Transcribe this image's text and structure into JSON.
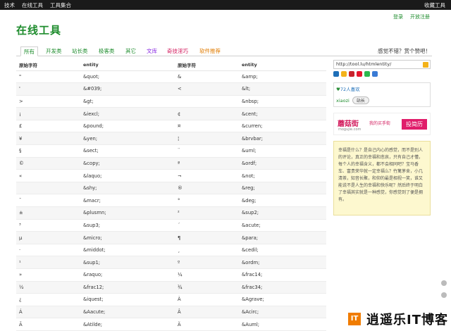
{
  "topbar": {
    "left": [
      "技术",
      "在线工具",
      "工具集合"
    ],
    "right": "收藏工具"
  },
  "user_links": {
    "login": "登录",
    "register": "开放注册"
  },
  "site_title": "在线工具",
  "tabs": [
    {
      "label": "所有",
      "color": "#1e8c2d"
    },
    {
      "label": "开发类",
      "color": "#1e8c2d"
    },
    {
      "label": "站长类",
      "color": "#1e8c2d"
    },
    {
      "label": "极客类",
      "color": "#1e8c2d"
    },
    {
      "label": "其它",
      "color": "#1e8c2d"
    },
    {
      "label": "文库",
      "color": "#8a2be2"
    },
    {
      "label": "奇技淫巧",
      "color": "#d21a5c"
    },
    {
      "label": "软件推荐",
      "color": "#e07b00"
    }
  ],
  "slogan": "感觉不错？赏个赞吧！",
  "table": {
    "headers": [
      "原始字符",
      "entity",
      "原始字符",
      "entity"
    ],
    "rows": [
      [
        "\"",
        "&quot;",
        "&",
        "&amp;"
      ],
      [
        "'",
        "&#039;",
        "<",
        "&lt;"
      ],
      [
        ">",
        "&gt;",
        "",
        "&nbsp;"
      ],
      [
        "¡",
        "&iexcl;",
        "¢",
        "&cent;"
      ],
      [
        "£",
        "&pound;",
        "¤",
        "&curren;"
      ],
      [
        "¥",
        "&yen;",
        "¦",
        "&brvbar;"
      ],
      [
        "§",
        "&sect;",
        "¨",
        "&uml;"
      ],
      [
        "©",
        "&copy;",
        "ª",
        "&ordf;"
      ],
      [
        "«",
        "&laquo;",
        "¬",
        "&not;"
      ],
      [
        "",
        "&shy;",
        "®",
        "&reg;"
      ],
      [
        "¯",
        "&macr;",
        "°",
        "&deg;"
      ],
      [
        "±",
        "&plusmn;",
        "²",
        "&sup2;"
      ],
      [
        "³",
        "&sup3;",
        "´",
        "&acute;"
      ],
      [
        "µ",
        "&micro;",
        "¶",
        "&para;"
      ],
      [
        "·",
        "&middot;",
        "¸",
        "&cedil;"
      ],
      [
        "¹",
        "&sup1;",
        "º",
        "&ordm;"
      ],
      [
        "»",
        "&raquo;",
        "¼",
        "&frac14;"
      ],
      [
        "½",
        "&frac12;",
        "¾",
        "&frac34;"
      ],
      [
        "¿",
        "&iquest;",
        "À",
        "&Agrave;"
      ],
      [
        "Á",
        "&Aacute;",
        "Â",
        "&Acirc;"
      ],
      [
        "Ã",
        "&Atilde;",
        "Ä",
        "&Auml;"
      ]
    ]
  },
  "sidebar": {
    "url": "http://tool.lu/htmlentity/",
    "share_icons": [
      {
        "name": "plus-share-icon",
        "color": "#1e6fb8"
      },
      {
        "name": "star-share-icon",
        "color": "#f3b21a"
      },
      {
        "name": "pinterest-icon",
        "color": "#c8232c"
      },
      {
        "name": "weibo-icon",
        "color": "#e6162d"
      },
      {
        "name": "wechat-icon",
        "color": "#2db84d"
      },
      {
        "name": "qzone-icon",
        "color": "#3a7bd5"
      }
    ],
    "likes": "72人喜欢",
    "user": "xiaozi",
    "user_btn": "站长",
    "ad": {
      "brand": "蘑菇街",
      "brand_sub": "mogujie.com",
      "promo": "我的买手街",
      "button": "投简历"
    },
    "note": "幸福是什么？是自己内心的感觉，而不是别人的评论，真正的幸福和悲哀，只有自己才懂，每个人的幸福含义，都不会相同吧？宝马香车、富贵荣华就一定幸福么？竹篱茅舍，小几清茶，知音长聚，和仰的最是相视一笑，谁又能说不是人生的幸福和快乐呢？然后终于明白了幸福其实就是一种感觉，你感觉到了便是拥有。"
  },
  "watermark": {
    "logo": "IT",
    "text": "逍遥乐IT博客"
  }
}
